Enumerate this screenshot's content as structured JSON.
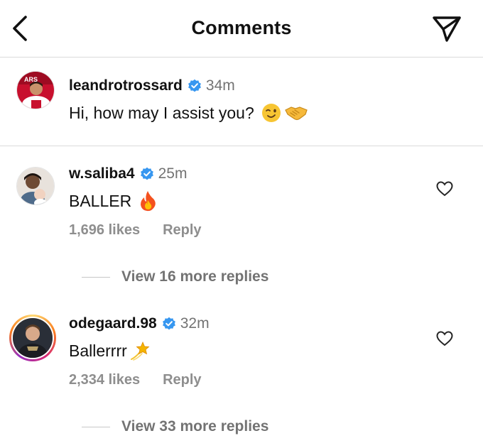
{
  "header": {
    "title": "Comments",
    "back_icon": "chevron-left-icon",
    "send_icon": "paper-plane-icon"
  },
  "caption": {
    "username": "leandrotrossard",
    "verified": true,
    "time": "34m",
    "text": "Hi, how may I assist you?",
    "emojis": [
      "winking-face-emoji",
      "handshake-emoji"
    ]
  },
  "comments": [
    {
      "username": "w.saliba4",
      "verified": true,
      "time": "25m",
      "text": "BALLER",
      "emoji": "fire-emoji",
      "likes": "1,696 likes",
      "reply_label": "Reply",
      "view_replies": "View 16 more replies"
    },
    {
      "username": "odegaard.98",
      "verified": true,
      "time": "32m",
      "text": "Ballerrrr",
      "emoji": "dizzy-emoji",
      "likes": "2,334 likes",
      "reply_label": "Reply",
      "view_replies": "View 33 more replies",
      "has_story_ring": true
    }
  ],
  "colors": {
    "verified_blue": "#3797f0",
    "secondary_text": "#737373",
    "divider": "#dbdbdb"
  }
}
